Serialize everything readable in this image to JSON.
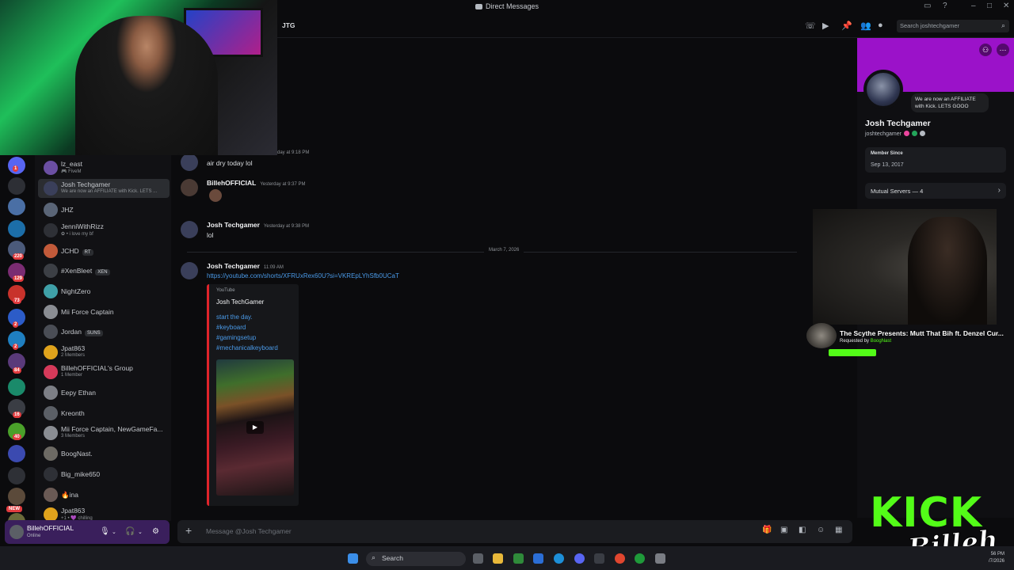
{
  "window": {
    "title": "Direct Messages"
  },
  "header": {
    "channel": "JTG",
    "search_placeholder": "Search joshtechgamer"
  },
  "dm_list": [
    {
      "name": "lz_east",
      "sub": "🎮 FiveM",
      "color": "#6b4fa3"
    },
    {
      "name": "Josh Techgamer",
      "sub": "We are now an AFFILIATE with Kick. LETS ...",
      "color": "#3a3f5a",
      "active": true
    },
    {
      "name": "JHZ",
      "sub": "",
      "color": "#5a6577"
    },
    {
      "name": "JenniWithRizz",
      "sub": "✿ • i love my bf",
      "color": "#2e3036"
    },
    {
      "name": "JCHD",
      "sub": "",
      "tag": "RT",
      "color": "#c25a3a"
    },
    {
      "name": "#XenBleet",
      "sub": "",
      "tag": "XEN",
      "color": "#3c3f45"
    },
    {
      "name": "NightZero",
      "sub": "",
      "color": "#3fa0a8"
    },
    {
      "name": "Mii Force Captain",
      "sub": "",
      "color": "#8a8d93"
    },
    {
      "name": "Jordan",
      "sub": "",
      "tag": "SUNS",
      "color": "#4a4d55"
    },
    {
      "name": "Jpat863",
      "sub": "2 Members",
      "color": "#e0a31c"
    },
    {
      "name": "BillehOFFICIAL's Group",
      "sub": "1 Member",
      "color": "#d63a5a"
    },
    {
      "name": "Eepy Ethan",
      "sub": "",
      "color": "#7d7f86"
    },
    {
      "name": "Kreonth",
      "sub": "",
      "color": "#5b5f66"
    },
    {
      "name": "Mii Force Captain, NewGameFa...",
      "sub": "3 Members",
      "color": "#8a8d93"
    },
    {
      "name": "BoogNast.",
      "sub": "",
      "color": "#6d6a64"
    },
    {
      "name": "Big_mike650",
      "sub": "",
      "color": "#2e3036"
    },
    {
      "name": "🔥ina",
      "sub": "",
      "color": "#6a5a55"
    },
    {
      "name": "Jpat863",
      "sub": "+1 • 💜 chilling",
      "color": "#e0a31c"
    }
  ],
  "rail_badges": [
    "1",
    "220",
    "129",
    "73",
    "2",
    "2",
    "84",
    "16",
    "40"
  ],
  "rail_new": "NEW",
  "user_panel": {
    "name": "BillehOFFICIAL",
    "status": "Online"
  },
  "messages": {
    "m0_ts": "day at 9:18 PM",
    "m0_text": "air dry today lol",
    "m1_author": "BillehOFFICIAL",
    "m1_ts": "Yesterday at 9:37 PM",
    "m2_author": "Josh Techgamer",
    "m2_ts": "Yesterday at 9:38 PM",
    "m2_text": "lol",
    "date_divider": "March 7, 2026",
    "m3_author": "Josh Techgamer",
    "m3_ts": "11:09 AM",
    "m3_link": "https://youtube.com/shorts/XFRUxRex60U?si=VKREpLYhSfb0UCaT"
  },
  "embed": {
    "provider": "YouTube",
    "title": "Josh TechGamer",
    "lines": [
      "start the day.",
      "#keyboard",
      "#gamingsetup",
      "#mechanicalkeyboard"
    ]
  },
  "composer": {
    "placeholder": "Message @Josh Techgamer"
  },
  "profile": {
    "status_bubble": "We are now an AFFILIATE with Kick. LETS GOOO",
    "display_name": "Josh Techgamer",
    "username": "joshtechgamer",
    "member_since_label": "Member Since",
    "member_since": "Sep 13, 2017",
    "mutual_servers": "Mutual Servers — 4"
  },
  "media_overlay": {
    "song_title": "The Scythe Presents: Mutt That Bih ft. Denzel Cur...",
    "requested_by_label": "Requested by",
    "requested_by": "BoogNast"
  },
  "stream_logo": {
    "word": "KICK",
    "sub": "Billeh"
  },
  "taskbar": {
    "search": "Search",
    "time": "56 PM",
    "date": "/7/2026"
  },
  "colors": {
    "accent": "#5865f2",
    "kick_green": "#53fc18",
    "banner": "#9b12c9",
    "link": "#4a9ae8"
  }
}
